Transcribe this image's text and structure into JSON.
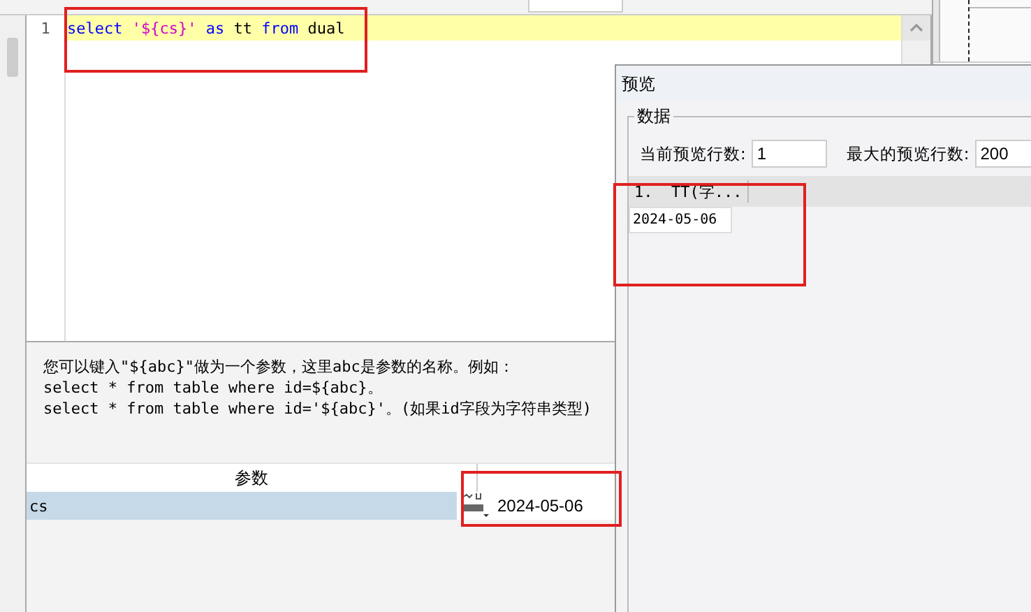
{
  "editor": {
    "lines": [
      {
        "number": "1",
        "current": true,
        "tokens": [
          {
            "kind": "keyword",
            "text": "select "
          },
          {
            "kind": "string",
            "text": "'${cs}'"
          },
          {
            "kind": "keyword",
            "text": " as"
          },
          {
            "kind": "plain",
            "text": " tt "
          },
          {
            "kind": "keyword",
            "text": "from"
          },
          {
            "kind": "plain",
            "text": " dual"
          }
        ]
      }
    ]
  },
  "hint": {
    "lines": [
      "您可以键入\"${abc}\"做为一个参数，这里abc是参数的名称。例如：",
      "select * from table where id=${abc}。",
      "select * from table where id='${abc}'。(如果id字段为字符串类型)"
    ]
  },
  "parameters": {
    "columns": [
      "参数"
    ],
    "rows": [
      {
        "name": "cs",
        "selected": true,
        "value": "2024-05-06"
      }
    ]
  },
  "preview": {
    "title": "预览",
    "group": "数据",
    "fields": [
      {
        "label": "当前预览行数:",
        "value": "1"
      },
      {
        "label": "最大的预览行数:",
        "value": "200"
      }
    ],
    "grid": {
      "columns": [
        "1.  TT(字..."
      ],
      "rows": [
        [
          "2024-05-06"
        ]
      ]
    }
  }
}
